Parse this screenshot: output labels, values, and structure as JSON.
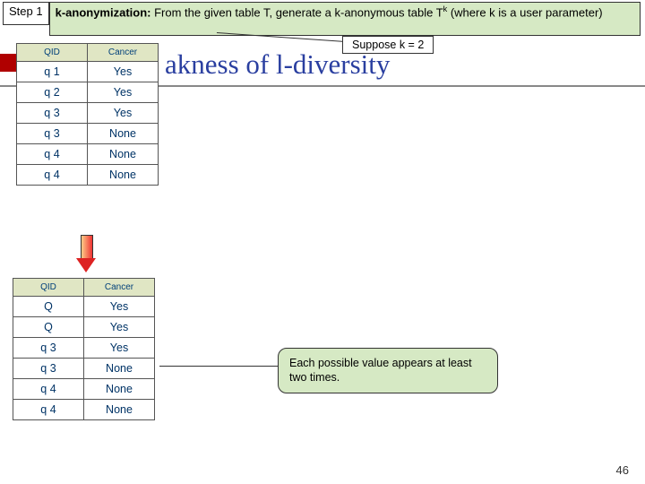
{
  "chart_data": [
    {
      "type": "table",
      "title": "Input table T",
      "columns": [
        "QID",
        "Cancer"
      ],
      "rows": [
        [
          "q 1",
          "Yes"
        ],
        [
          "q 2",
          "Yes"
        ],
        [
          "q 3",
          "Yes"
        ],
        [
          "q 3",
          "None"
        ],
        [
          "q 4",
          "None"
        ],
        [
          "q 4",
          "None"
        ]
      ]
    },
    {
      "type": "table",
      "title": "k-anonymous table Tk",
      "columns": [
        "QID",
        "Cancer"
      ],
      "rows": [
        [
          "Q",
          "Yes"
        ],
        [
          "Q",
          "Yes"
        ],
        [
          "q 3",
          "Yes"
        ],
        [
          "q 3",
          "None"
        ],
        [
          "q 4",
          "None"
        ],
        [
          "q 4",
          "None"
        ]
      ]
    }
  ],
  "step": {
    "label": "Step 1",
    "bold": "k-anonymization:",
    "rest": " From the given table T, generate a k-anonymous table T",
    "sup": "k",
    "tail": " (where k is a user parameter)"
  },
  "suppose": "Suppose k = 2",
  "title": "akness of l-diversity",
  "table1": {
    "h1": "QID",
    "h2": "Cancer",
    "r": [
      [
        "q 1",
        "Yes"
      ],
      [
        "q 2",
        "Yes"
      ],
      [
        "q 3",
        "Yes"
      ],
      [
        "q 3",
        "None"
      ],
      [
        "q 4",
        "None"
      ],
      [
        "q 4",
        "None"
      ]
    ]
  },
  "table2": {
    "h1": "QID",
    "h2": "Cancer",
    "r": [
      [
        "Q",
        "Yes"
      ],
      [
        "Q",
        "Yes"
      ],
      [
        "q 3",
        "Yes"
      ],
      [
        "q 3",
        "None"
      ],
      [
        "q 4",
        "None"
      ],
      [
        "q 4",
        "None"
      ]
    ]
  },
  "callout": "Each possible value appears at least two times.",
  "slidenum": "46"
}
